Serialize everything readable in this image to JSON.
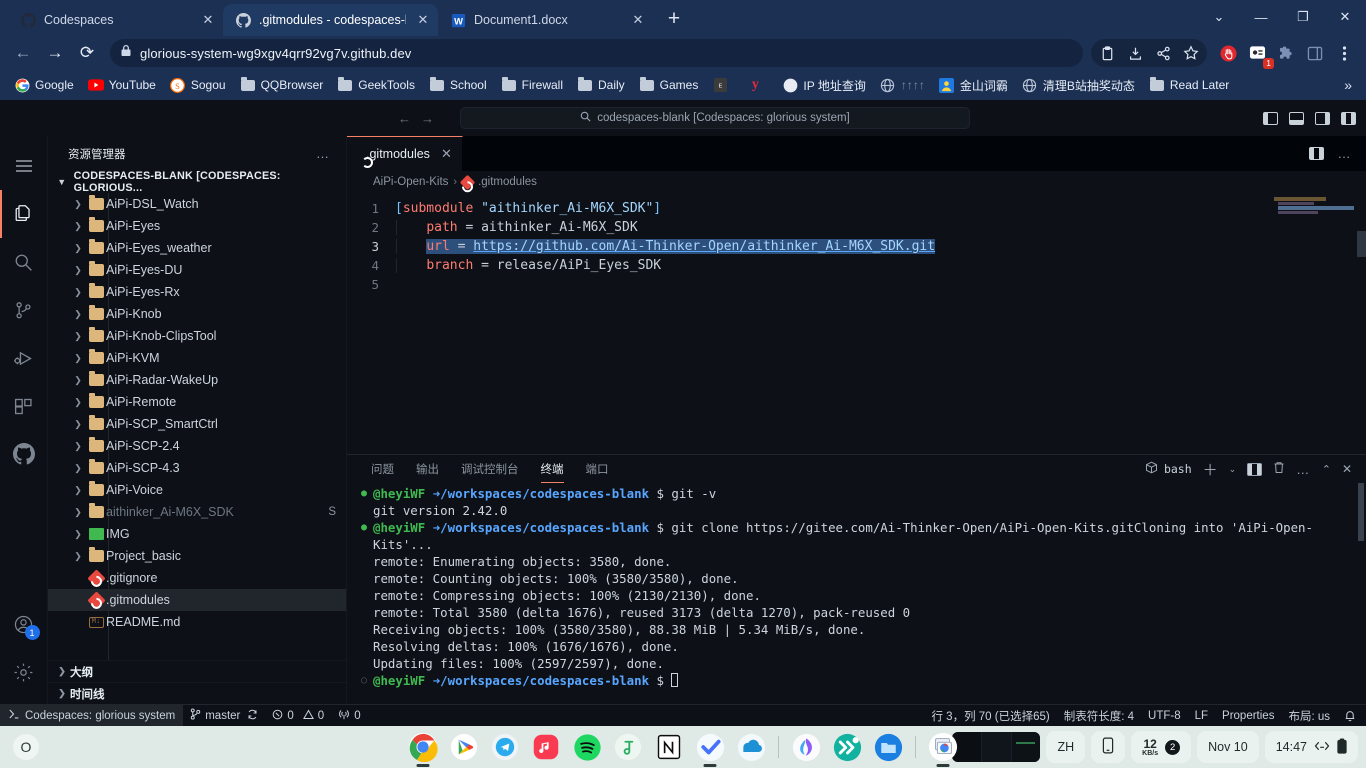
{
  "browser": {
    "tabs": [
      {
        "title": "Codespaces",
        "icon": "github-icon",
        "active": false
      },
      {
        "title": ".gitmodules - codespaces-blank",
        "icon": "github-icon",
        "active": true
      },
      {
        "title": "Document1.docx",
        "icon": "word-icon",
        "active": false
      }
    ],
    "new_tab_label": "+",
    "window_controls": {
      "dropdown": "⌄",
      "minimize": "—",
      "restore": "❐",
      "close": "✕"
    },
    "nav": {
      "back": "←",
      "forward": "→",
      "reload": "⟳"
    },
    "omnibox": {
      "lock_icon": "lock-icon",
      "url": "glorious-system-wg9xgv4qrr92vg7v.github.dev"
    },
    "toolbar_icons": [
      "clipboard-icon",
      "download-icon",
      "share-icon",
      "bookmark-star-icon",
      "stop-hand-icon",
      "extension-badge-icon",
      "puzzle-icon",
      "sidepanel-icon",
      "menu-kebab-icon"
    ],
    "extension_badge_count": "1",
    "bookmarks": [
      {
        "label": "Google",
        "icon": "google-icon"
      },
      {
        "label": "YouTube",
        "icon": "youtube-icon"
      },
      {
        "label": "Sogou",
        "icon": "sogou-icon"
      },
      {
        "label": "QQBrowser",
        "icon": "folder-icon"
      },
      {
        "label": "GeekTools",
        "icon": "folder-icon"
      },
      {
        "label": "School",
        "icon": "folder-icon"
      },
      {
        "label": "Firewall",
        "icon": "folder-icon"
      },
      {
        "label": "Daily",
        "icon": "folder-icon"
      },
      {
        "label": "Games",
        "icon": "folder-icon"
      },
      {
        "label": "",
        "icon": "epic-icon"
      },
      {
        "label": "",
        "icon": "y-icon"
      },
      {
        "label": "IP 地址查询",
        "icon": "moon-icon"
      },
      {
        "label": "↑↑↑↑",
        "icon": "globe-icon"
      },
      {
        "label": "金山词霸",
        "icon": "kingsoft-icon"
      },
      {
        "label": "清理B站抽奖动态",
        "icon": "globe-icon"
      },
      {
        "label": "Read Later",
        "icon": "folder-icon"
      }
    ],
    "bookmarks_overflow": "»"
  },
  "vscode": {
    "quickinput_placeholder": "codespaces-blank [Codespaces: glorious system]",
    "nav": {
      "back": "←",
      "forward": "→"
    },
    "activitybar": [
      {
        "name": "menu-hamburger-icon",
        "label": ""
      },
      {
        "name": "explorer-icon",
        "label": "",
        "active": true
      },
      {
        "name": "search-icon",
        "label": ""
      },
      {
        "name": "source-control-icon",
        "label": ""
      },
      {
        "name": "run-debug-icon",
        "label": ""
      },
      {
        "name": "extensions-icon",
        "label": ""
      },
      {
        "name": "github-icon",
        "label": ""
      },
      {
        "name": "account-icon",
        "label": "",
        "badge": "1"
      },
      {
        "name": "settings-gear-icon",
        "label": ""
      }
    ],
    "sidebar": {
      "title": "资源管理器",
      "more_actions": "…",
      "root_label": "CODESPACES-BLANK [CODESPACES: GLORIOUS...",
      "tree": [
        {
          "name": "AiPi-DSL_Watch",
          "type": "folder",
          "suffix": ""
        },
        {
          "name": "AiPi-Eyes",
          "type": "folder",
          "suffix": ""
        },
        {
          "name": "AiPi-Eyes_weather",
          "type": "folder",
          "suffix": ""
        },
        {
          "name": "AiPi-Eyes-DU",
          "type": "folder",
          "suffix": ""
        },
        {
          "name": "AiPi-Eyes-Rx",
          "type": "folder",
          "suffix": ""
        },
        {
          "name": "AiPi-Knob",
          "type": "folder",
          "suffix": ""
        },
        {
          "name": "AiPi-Knob-ClipsTool",
          "type": "folder",
          "suffix": ""
        },
        {
          "name": "AiPi-KVM",
          "type": "folder",
          "suffix": ""
        },
        {
          "name": "AiPi-Radar-WakeUp",
          "type": "folder",
          "suffix": ""
        },
        {
          "name": "AiPi-Remote",
          "type": "folder",
          "suffix": ""
        },
        {
          "name": "AiPi-SCP_SmartCtrl",
          "type": "folder",
          "suffix": ""
        },
        {
          "name": "AiPi-SCP-2.4",
          "type": "folder",
          "suffix": ""
        },
        {
          "name": "AiPi-SCP-4.3",
          "type": "folder",
          "suffix": ""
        },
        {
          "name": "AiPi-Voice",
          "type": "folder",
          "suffix": ""
        },
        {
          "name": "aithinker_Ai-M6X_SDK",
          "type": "folder-dim",
          "suffix": "S"
        },
        {
          "name": "IMG",
          "type": "folder-img",
          "suffix": ""
        },
        {
          "name": "Project_basic",
          "type": "folder",
          "suffix": ""
        },
        {
          "name": ".gitignore",
          "type": "git",
          "suffix": ""
        },
        {
          "name": ".gitmodules",
          "type": "git",
          "suffix": "",
          "selected": true
        },
        {
          "name": "README.md",
          "type": "md",
          "suffix": ""
        }
      ],
      "bottom_sections": [
        {
          "label": "大纲"
        },
        {
          "label": "时间线"
        }
      ]
    },
    "editor": {
      "tab": {
        "label": ".gitmodules",
        "icon": "git-file-icon",
        "close": "✕"
      },
      "tab_actions": {
        "split": "split-editor-icon",
        "more": "…"
      },
      "breadcrumb": [
        {
          "label": "AiPi-Open-Kits",
          "icon": ""
        },
        {
          "label": ".gitmodules",
          "icon": "git-file-icon"
        }
      ],
      "breadcrumb_separator": "›",
      "lines": [
        {
          "num": "1",
          "tokens": [
            {
              "t": "[",
              "c": "br"
            },
            {
              "t": "submodule ",
              "c": "key"
            },
            {
              "t": "\"aithinker_Ai-M6X_SDK\"",
              "c": "str"
            },
            {
              "t": "]",
              "c": "br"
            }
          ]
        },
        {
          "num": "2",
          "tokens": [
            {
              "t": "    ",
              "c": "val"
            },
            {
              "t": "path",
              "c": "key"
            },
            {
              "t": " = ",
              "c": "eq"
            },
            {
              "t": "aithinker_Ai-M6X_SDK",
              "c": "val"
            }
          ]
        },
        {
          "num": "3",
          "tokens": [
            {
              "t": "    ",
              "c": "val"
            },
            {
              "t": "url",
              "c": "key-sel"
            },
            {
              "t": " = ",
              "c": "eq-sel"
            },
            {
              "t": "https://github.com/Ai-Thinker-Open/aithinker_Ai-M6X_SDK.git",
              "c": "url-sel"
            }
          ]
        },
        {
          "num": "4",
          "tokens": [
            {
              "t": "    ",
              "c": "val"
            },
            {
              "t": "branch",
              "c": "key"
            },
            {
              "t": " = ",
              "c": "eq"
            },
            {
              "t": "release/AiPi_Eyes_SDK",
              "c": "val"
            }
          ]
        },
        {
          "num": "5",
          "tokens": []
        }
      ]
    },
    "panel": {
      "tabs": [
        {
          "label": "问题",
          "active": false
        },
        {
          "label": "输出",
          "active": false
        },
        {
          "label": "调试控制台",
          "active": false
        },
        {
          "label": "终端",
          "active": true
        },
        {
          "label": "端口",
          "active": false
        }
      ],
      "shell_label": "bash",
      "actions": [
        "add-terminal-icon",
        "chevron-down-icon",
        "split-terminal-icon",
        "kill-terminal-icon",
        "more-icon",
        "maximize-icon",
        "close-icon"
      ],
      "terminal_lines": [
        {
          "type": "prompt",
          "dot": "green",
          "user": "@heyiWF",
          "arrow": "➜",
          "path": "/workspaces/codespaces-blank",
          "sym": "$",
          "cmd": " git -v"
        },
        {
          "type": "out",
          "text": "git version 2.42.0"
        },
        {
          "type": "prompt",
          "dot": "green",
          "user": "@heyiWF",
          "arrow": "➜",
          "path": "/workspaces/codespaces-blank",
          "sym": "$",
          "cmd": " git clone https://gitee.com/Ai-Thinker-Open/AiPi-Open-Kits.gitCloning into 'AiPi-Open-Kits'..."
        },
        {
          "type": "out",
          "text": "remote: Enumerating objects: 3580, done."
        },
        {
          "type": "out",
          "text": "remote: Counting objects: 100% (3580/3580), done."
        },
        {
          "type": "out",
          "text": "remote: Compressing objects: 100% (2130/2130), done."
        },
        {
          "type": "out",
          "text": "remote: Total 3580 (delta 1676), reused 3173 (delta 1270), pack-reused 0"
        },
        {
          "type": "out",
          "text": "Receiving objects: 100% (3580/3580), 88.38 MiB | 5.34 MiB/s, done."
        },
        {
          "type": "out",
          "text": "Resolving deltas: 100% (1676/1676), done."
        },
        {
          "type": "out",
          "text": "Updating files: 100% (2597/2597), done."
        },
        {
          "type": "prompt",
          "dot": "gray",
          "user": "@heyiWF",
          "arrow": "➜",
          "path": "/workspaces/codespaces-blank",
          "sym": "$",
          "cmd": "",
          "cursor": true
        }
      ]
    },
    "statusbar": {
      "remote_label": "Codespaces: glorious system",
      "remote_icon": "remote-icon",
      "branch": "master",
      "branch_icon": "branch-icon",
      "sync_icon": "sync-icon",
      "errors": "0",
      "warnings": "0",
      "ports": "0",
      "ports_icon": "radio-tower-icon",
      "position": "行 3，列 70 (已选择65)",
      "indent": "制表符长度: 4",
      "encoding": "UTF-8",
      "eol": "LF",
      "language": "Properties",
      "layout": "布局: us",
      "bell_icon": "bell-icon"
    }
  },
  "taskbar": {
    "start_icon": "start-circle-icon",
    "apps": [
      {
        "name": "chrome-icon",
        "running": true
      },
      {
        "name": "google-play-icon",
        "running": false
      },
      {
        "name": "telegram-icon",
        "running": false
      },
      {
        "name": "apple-music-icon",
        "running": false
      },
      {
        "name": "spotify-icon",
        "running": false
      },
      {
        "name": "alist-icon",
        "running": false
      },
      {
        "name": "notion-icon",
        "running": false
      },
      {
        "name": "ticktick-icon",
        "running": false
      },
      {
        "name": "onedrive-icon",
        "running": false
      },
      {
        "name": "copilot-icon",
        "running": false
      },
      {
        "name": "fastgithub-icon",
        "running": false
      },
      {
        "name": "file-explorer-icon",
        "running": false
      },
      {
        "name": "edge-apps-icon",
        "running": true
      }
    ],
    "preview_thumb": "window-preview",
    "tray": {
      "ime": "ZH",
      "phone_icon": "phone-link-icon",
      "net_speed_value": "12",
      "net_speed_unit": "KB/s",
      "net_badge": "2",
      "date": "Nov 10",
      "time": "14:47",
      "connect_icon": "connect-icon",
      "battery_icon": "battery-icon"
    }
  }
}
